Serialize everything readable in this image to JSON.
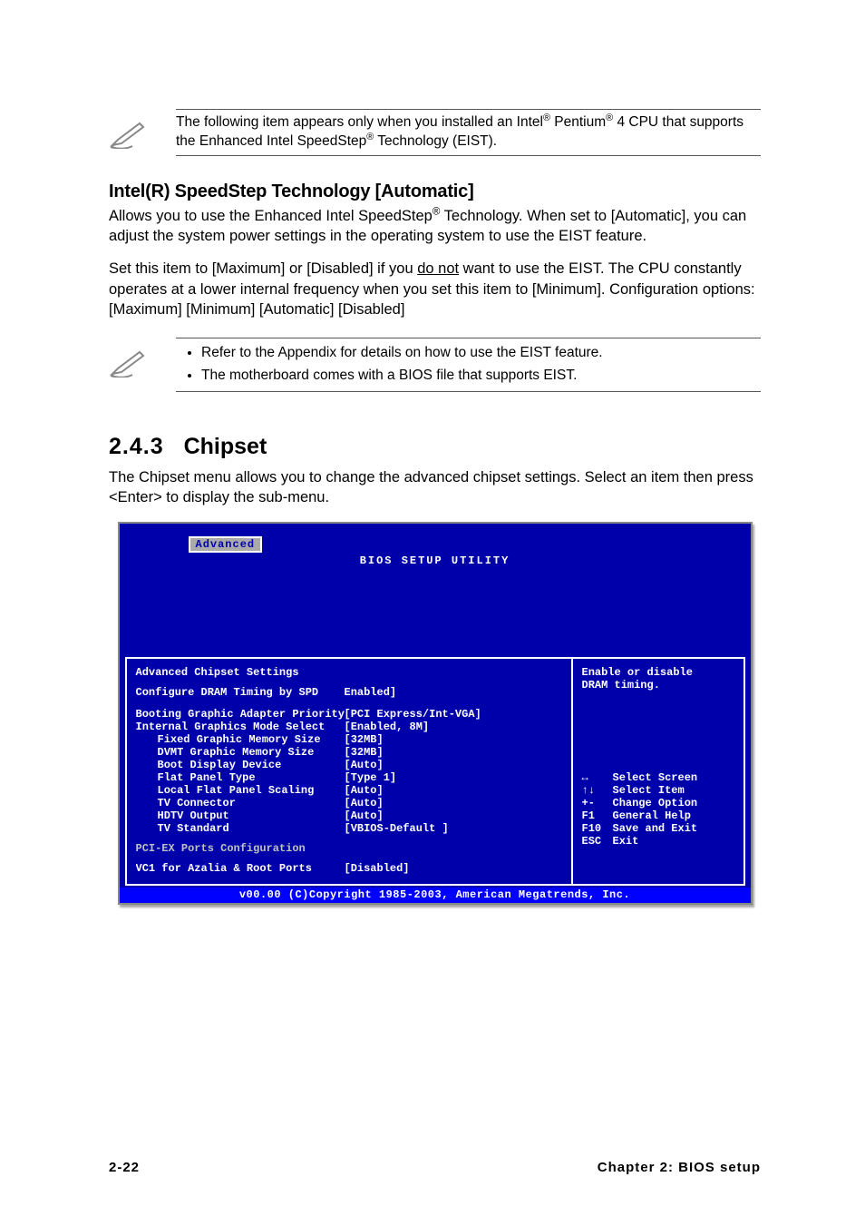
{
  "note1": {
    "pre": "The following item appears only when you installed an Intel",
    "mid1": " Pentium",
    "mid2": " 4 CPU that supports the Enhanced Intel SpeedStep",
    "tail": " Technology (EIST)."
  },
  "heading1": "Intel(R) SpeedStep Technology [Automatic]",
  "para1": {
    "a": "Allows you to use the Enhanced Intel SpeedStep",
    "b": " Technology. When set to [Automatic], you can adjust the system power settings in the operating system to use the EIST feature."
  },
  "para2": {
    "a": "Set this item to [Maximum] or [Disabled] if you ",
    "u": "do not",
    "b": " want to use the EIST. The CPU constantly operates at a lower internal frequency when you set this item to [Minimum]. Configuration options: [Maximum] [Minimum] [Automatic] [Disabled]"
  },
  "note2": {
    "b1": "Refer to the Appendix for details on how to use the EIST feature.",
    "b2": "The motherboard comes with a BIOS file that supports EIST."
  },
  "section": {
    "num": "2.4.3",
    "title": "Chipset"
  },
  "section_para": "The Chipset menu allows you to change the advanced chipset settings. Select an item then press <Enter> to display the sub-menu.",
  "bios": {
    "title": "BIOS SETUP UTILITY",
    "tab": "Advanced",
    "left_heading": "Advanced Chipset Settings",
    "rows": [
      {
        "label": "Configure DRAM Timing by SPD",
        "value": "Enabled]"
      },
      {
        "label": "Booting Graphic Adapter Priority",
        "value": "[PCI Express/Int-VGA]"
      },
      {
        "label": "Internal Graphics Mode Select",
        "value": "[Enabled, 8M]"
      },
      {
        "label": "Fixed Graphic Memory Size",
        "value": "[32MB]",
        "indent": true
      },
      {
        "label": "DVMT Graphic Memory Size",
        "value": "[32MB]",
        "indent": true
      },
      {
        "label": "Boot Display Device",
        "value": "[Auto]",
        "indent": true
      },
      {
        "label": "Flat Panel Type",
        "value": "[Type 1]",
        "indent": true
      },
      {
        "label": "Local Flat Panel Scaling",
        "value": "[Auto]",
        "indent": true
      },
      {
        "label": "TV Connector",
        "value": "[Auto]",
        "indent": true
      },
      {
        "label": "HDTV Output",
        "value": "[Auto]",
        "indent": true
      },
      {
        "label": "TV Standard",
        "value": "[VBIOS-Default ]",
        "indent": true
      }
    ],
    "pci_label": "PCI-EX Ports Configuration",
    "vc1": {
      "label": "VC1 for Azalia & Root Ports",
      "value": "[Disabled]"
    },
    "help": {
      "line1": "Enable or disable",
      "line2": "DRAM timing.",
      "keys": [
        {
          "k": "↔",
          "d": "Select Screen"
        },
        {
          "k": "↑↓",
          "d": "Select Item"
        },
        {
          "k": "+-",
          "d": "Change Option"
        },
        {
          "k": "F1",
          "d": "General Help"
        },
        {
          "k": "F10",
          "d": "Save and Exit"
        },
        {
          "k": "ESC",
          "d": "Exit"
        }
      ]
    },
    "footer": "v00.00 (C)Copyright 1985-2003, American Megatrends, Inc."
  },
  "footer": {
    "left": "2-22",
    "right": "Chapter 2: BIOS setup"
  }
}
